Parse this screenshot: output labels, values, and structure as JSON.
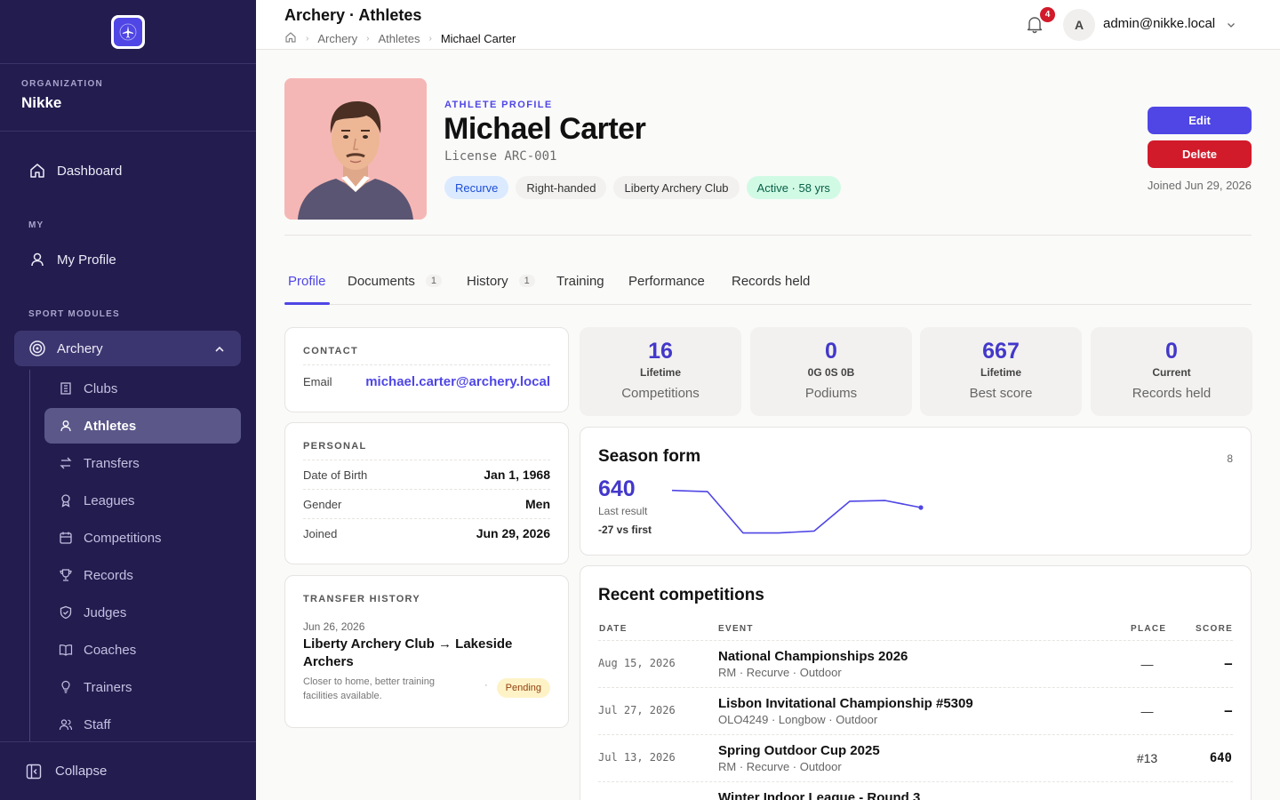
{
  "sidebar": {
    "org_label": "ORGANIZATION",
    "org_name": "Nikke",
    "dashboard": "Dashboard",
    "my_label": "MY",
    "my_profile": "My Profile",
    "sport_label": "SPORT MODULES",
    "archery": "Archery",
    "sub_items": [
      "Clubs",
      "Athletes",
      "Transfers",
      "Leagues",
      "Competitions",
      "Records",
      "Judges",
      "Coaches",
      "Trainers",
      "Staff"
    ],
    "active_sub": "Athletes",
    "collapse": "Collapse"
  },
  "header": {
    "title": "Archery · Athletes",
    "breadcrumbs": [
      "Archery",
      "Athletes",
      "Michael Carter"
    ],
    "notifications": "4",
    "avatar_letter": "A",
    "user": "admin@nikke.local"
  },
  "profile": {
    "kicker": "ATHLETE PROFILE",
    "name": "Michael Carter",
    "license": "License ARC-001",
    "chips": [
      "Recurve",
      "Right-handed",
      "Liberty Archery Club",
      "Active · 58 yrs"
    ],
    "edit": "Edit",
    "delete": "Delete",
    "joined": "Joined Jun 29, 2026"
  },
  "tabs": [
    {
      "label": "Profile",
      "count": ""
    },
    {
      "label": "Documents",
      "count": "1"
    },
    {
      "label": "History",
      "count": "1"
    },
    {
      "label": "Training",
      "count": ""
    },
    {
      "label": "Performance",
      "count": ""
    },
    {
      "label": "Records held",
      "count": ""
    }
  ],
  "contact": {
    "label": "CONTACT",
    "email_key": "Email",
    "email": "michael.carter@archery.local"
  },
  "personal": {
    "label": "PERSONAL",
    "rows": [
      {
        "k": "Date of Birth",
        "v": "Jan 1, 1968"
      },
      {
        "k": "Gender",
        "v": "Men"
      },
      {
        "k": "Joined",
        "v": "Jun 29, 2026"
      }
    ]
  },
  "transfer": {
    "label": "TRANSFER HISTORY",
    "date": "Jun 26, 2026",
    "from": "Liberty Archery Club",
    "arrow": "→",
    "to": "Lakeside Archers",
    "note": "Closer to home, better training facilities available.",
    "dot": "·",
    "status": "Pending"
  },
  "stats": [
    {
      "num": "16",
      "sub": "Lifetime",
      "label": "Competitions"
    },
    {
      "num": "0",
      "sub": "0G 0S 0B",
      "label": "Podiums"
    },
    {
      "num": "667",
      "sub": "Lifetime",
      "label": "Best score"
    },
    {
      "num": "0",
      "sub": "Current",
      "label": "Records held"
    }
  ],
  "season": {
    "title": "Season form",
    "count": "8",
    "value": "640",
    "value_label": "Last result",
    "delta": "-27 vs first"
  },
  "chart_data": {
    "type": "line",
    "x": [
      1,
      2,
      3,
      4,
      5,
      6,
      7,
      8
    ],
    "values": [
      667,
      665,
      600,
      600,
      603,
      650,
      651,
      640
    ]
  },
  "recent": {
    "title": "Recent competitions",
    "headers": {
      "date": "DATE",
      "event": "EVENT",
      "place": "PLACE",
      "score": "SCORE"
    },
    "rows": [
      {
        "date": "Aug 15, 2026",
        "event": "National Championships 2026",
        "sub": "RM · Recurve · Outdoor",
        "place": "—",
        "score": "–"
      },
      {
        "date": "Jul 27, 2026",
        "event": "Lisbon Invitational Championship #5309",
        "sub": "OLO4249 · Longbow · Outdoor",
        "place": "—",
        "score": "–"
      },
      {
        "date": "Jul 13, 2026",
        "event": "Spring Outdoor Cup 2025",
        "sub": "RM · Recurve · Outdoor",
        "place": "#13",
        "score": "640"
      },
      {
        "date": "",
        "event": "Winter Indoor League - Round 3",
        "sub": "",
        "place": "",
        "score": ""
      }
    ]
  },
  "colors": {
    "sidebar": "#221c4f",
    "accent": "#4f46e5",
    "danger": "#d11a2a"
  }
}
